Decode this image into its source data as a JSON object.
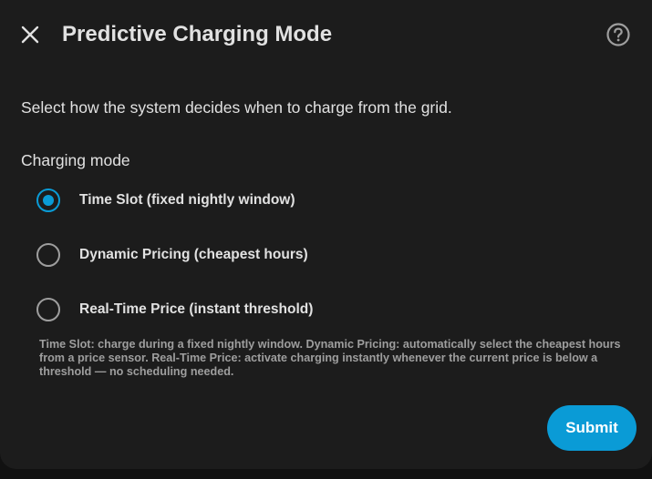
{
  "dialog": {
    "title": "Predictive Charging Mode",
    "description": "Select how the system decides when to charge from the grid.",
    "close_icon": "close-icon",
    "help_icon": "help-circle-icon"
  },
  "charging_mode": {
    "label": "Charging mode",
    "selected": "time_slot",
    "options": [
      {
        "id": "time_slot",
        "label": "Time Slot (fixed nightly window)",
        "checked": true
      },
      {
        "id": "dynamic_pricing",
        "label": "Dynamic Pricing (cheapest hours)",
        "checked": false
      },
      {
        "id": "real_time_price",
        "label": "Real-Time Price (instant threshold)",
        "checked": false
      }
    ],
    "helper_text": "Time Slot: charge during a fixed nightly window. Dynamic Pricing: automatically select the cheapest hours from a price sensor. Real-Time Price: activate charging instantly whenever the current price is below a threshold — no scheduling needed."
  },
  "actions": {
    "submit_label": "Submit"
  },
  "colors": {
    "accent": "#0a9bd6",
    "surface": "#1c1c1c",
    "text_primary": "#e1e1e1",
    "text_secondary": "#9e9e9e"
  }
}
